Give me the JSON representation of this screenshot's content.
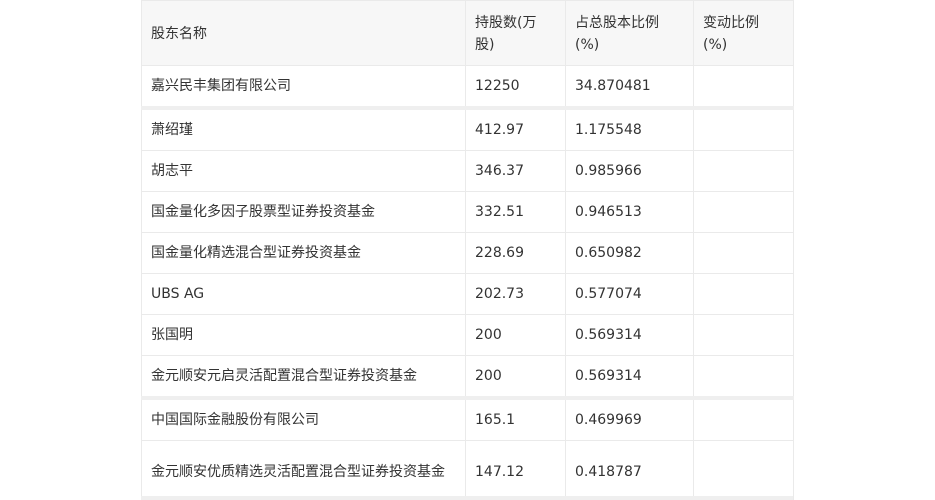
{
  "table": {
    "headers": [
      "股东名称",
      "持股数(万股)",
      "占总股本比例(%)",
      "变动比例(%)"
    ],
    "rows": [
      {
        "name": "嘉兴民丰集团有限公司",
        "shares": "12250",
        "ratio": "34.870481",
        "change": ""
      },
      {
        "name": "萧绍瑾",
        "shares": "412.97",
        "ratio": "1.175548",
        "change": ""
      },
      {
        "name": "胡志平",
        "shares": "346.37",
        "ratio": "0.985966",
        "change": ""
      },
      {
        "name": "国金量化多因子股票型证券投资基金",
        "shares": "332.51",
        "ratio": "0.946513",
        "change": ""
      },
      {
        "name": "国金量化精选混合型证券投资基金",
        "shares": "228.69",
        "ratio": "0.650982",
        "change": ""
      },
      {
        "name": "UBS AG",
        "shares": "202.73",
        "ratio": "0.577074",
        "change": ""
      },
      {
        "name": "张国明",
        "shares": "200",
        "ratio": "0.569314",
        "change": ""
      },
      {
        "name": "金元顺安元启灵活配置混合型证券投资基金",
        "shares": "200",
        "ratio": "0.569314",
        "change": ""
      },
      {
        "name": "中国国际金融股份有限公司",
        "shares": "165.1",
        "ratio": "0.469969",
        "change": ""
      },
      {
        "name": "金元顺安优质精选灵活配置混合型证券投资基金",
        "shares": "147.12",
        "ratio": "0.418787",
        "change": ""
      }
    ]
  }
}
